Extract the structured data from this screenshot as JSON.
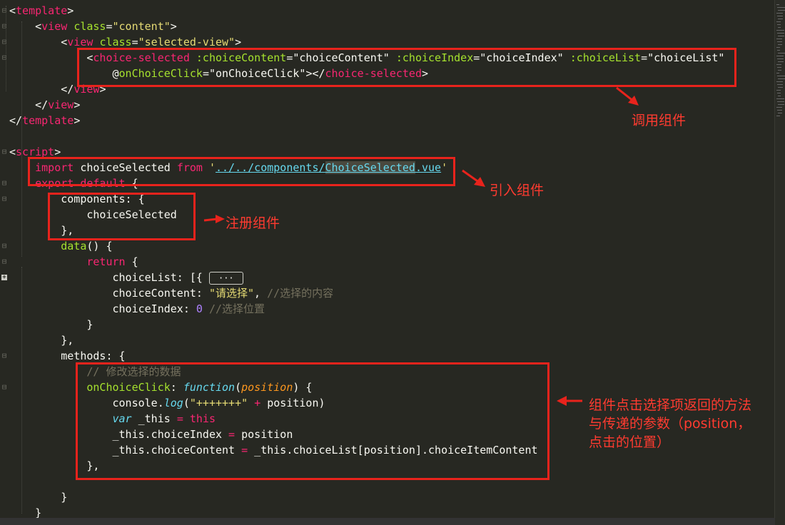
{
  "code_lines": [
    [
      {
        "c": "punc",
        "t": "<"
      },
      {
        "c": "tag",
        "t": "template"
      },
      {
        "c": "punc",
        "t": ">"
      }
    ],
    [
      {
        "c": "t",
        "t": "    "
      },
      {
        "c": "punc",
        "t": "<"
      },
      {
        "c": "tag",
        "t": "view"
      },
      {
        "c": "t",
        "t": " "
      },
      {
        "c": "attr",
        "t": "class"
      },
      {
        "c": "punc",
        "t": "="
      },
      {
        "c": "str",
        "t": "\"content\""
      },
      {
        "c": "punc",
        "t": ">"
      }
    ],
    [
      {
        "c": "t",
        "t": "        "
      },
      {
        "c": "punc",
        "t": "<"
      },
      {
        "c": "tag",
        "t": "view"
      },
      {
        "c": "t",
        "t": " "
      },
      {
        "c": "attr",
        "t": "class"
      },
      {
        "c": "punc",
        "t": "="
      },
      {
        "c": "str",
        "t": "\"selected-view\""
      },
      {
        "c": "punc",
        "t": ">"
      }
    ],
    [
      {
        "c": "t",
        "t": "            "
      },
      {
        "c": "punc",
        "t": "<"
      },
      {
        "c": "tag",
        "t": "choice-selected"
      },
      {
        "c": "t",
        "t": " "
      },
      {
        "c": "attr",
        "t": ":choiceContent"
      },
      {
        "c": "punc",
        "t": "="
      },
      {
        "c": "t",
        "t": "\"choiceContent\" "
      },
      {
        "c": "attr",
        "t": ":choiceIndex"
      },
      {
        "c": "punc",
        "t": "="
      },
      {
        "c": "t",
        "t": "\"choiceIndex\" "
      },
      {
        "c": "attr",
        "t": ":choiceList"
      },
      {
        "c": "punc",
        "t": "="
      },
      {
        "c": "t",
        "t": "\"choiceList\""
      }
    ],
    [
      {
        "c": "t",
        "t": "                "
      },
      {
        "c": "t",
        "t": "@"
      },
      {
        "c": "attr",
        "t": "onChoiceClick"
      },
      {
        "c": "punc",
        "t": "="
      },
      {
        "c": "t",
        "t": "\"onChoiceClick\""
      },
      {
        "c": "punc",
        "t": "></"
      },
      {
        "c": "tag",
        "t": "choice-selected"
      },
      {
        "c": "punc",
        "t": ">"
      }
    ],
    [
      {
        "c": "t",
        "t": "        "
      },
      {
        "c": "punc",
        "t": "</"
      },
      {
        "c": "tag",
        "t": "view"
      },
      {
        "c": "punc",
        "t": ">"
      }
    ],
    [
      {
        "c": "t",
        "t": "    "
      },
      {
        "c": "punc",
        "t": "</"
      },
      {
        "c": "tag",
        "t": "view"
      },
      {
        "c": "punc",
        "t": ">"
      }
    ],
    [
      {
        "c": "punc",
        "t": "</"
      },
      {
        "c": "tag",
        "t": "template"
      },
      {
        "c": "punc",
        "t": ">"
      }
    ],
    [],
    [
      {
        "c": "punc",
        "t": "<"
      },
      {
        "c": "tag",
        "t": "script"
      },
      {
        "c": "punc",
        "t": ">"
      }
    ],
    [
      {
        "c": "t",
        "t": "    "
      },
      {
        "c": "kw",
        "t": "import"
      },
      {
        "c": "t",
        "t": " choiceSelected "
      },
      {
        "c": "kw",
        "t": "from"
      },
      {
        "c": "t",
        "t": " "
      },
      {
        "c": "str",
        "t": "'"
      },
      {
        "c": "link",
        "t": "../../components/"
      },
      {
        "c": "link sel",
        "t": "ChoiceSelected"
      },
      {
        "c": "link",
        "t": ".vue"
      },
      {
        "c": "str",
        "t": "'"
      }
    ],
    [
      {
        "c": "t",
        "t": "    "
      },
      {
        "c": "kw",
        "t": "export"
      },
      {
        "c": "t",
        "t": " "
      },
      {
        "c": "kw",
        "t": "default"
      },
      {
        "c": "t",
        "t": " {"
      }
    ],
    [
      {
        "c": "t",
        "t": "        components: {"
      }
    ],
    [
      {
        "c": "t",
        "t": "            choiceSelected"
      }
    ],
    [
      {
        "c": "t",
        "t": "        },"
      }
    ],
    [
      {
        "c": "t",
        "t": "        "
      },
      {
        "c": "fn",
        "t": "data"
      },
      {
        "c": "t",
        "t": "() {"
      }
    ],
    [
      {
        "c": "t",
        "t": "            "
      },
      {
        "c": "kw",
        "t": "return"
      },
      {
        "c": "t",
        "t": " {"
      }
    ],
    [
      {
        "c": "t",
        "t": "                choiceList: [{ "
      },
      {
        "c": "fold-ellipsis",
        "t": "···"
      }
    ],
    [
      {
        "c": "t",
        "t": "                choiceContent: "
      },
      {
        "c": "str",
        "t": "\"请选择\""
      },
      {
        "c": "t",
        "t": ", "
      },
      {
        "c": "cm",
        "t": "//选择的内容"
      }
    ],
    [
      {
        "c": "t",
        "t": "                choiceIndex: "
      },
      {
        "c": "num",
        "t": "0"
      },
      {
        "c": "t",
        "t": " "
      },
      {
        "c": "cm",
        "t": "//选择位置"
      }
    ],
    [
      {
        "c": "t",
        "t": "            }"
      }
    ],
    [
      {
        "c": "t",
        "t": "        },"
      }
    ],
    [
      {
        "c": "t",
        "t": "        methods: {"
      }
    ],
    [
      {
        "c": "t",
        "t": "            "
      },
      {
        "c": "cm",
        "t": "// 修改选择的数据"
      }
    ],
    [
      {
        "c": "t",
        "t": "            "
      },
      {
        "c": "fn",
        "t": "onChoiceClick"
      },
      {
        "c": "t",
        "t": ": "
      },
      {
        "c": "em",
        "t": "function"
      },
      {
        "c": "t",
        "t": "("
      },
      {
        "c": "param",
        "t": "position"
      },
      {
        "c": "t",
        "t": ") {"
      }
    ],
    [
      {
        "c": "t",
        "t": "                console."
      },
      {
        "c": "em",
        "t": "log"
      },
      {
        "c": "t",
        "t": "("
      },
      {
        "c": "str",
        "t": "\"+++++++\""
      },
      {
        "c": "t",
        "t": " "
      },
      {
        "c": "kw",
        "t": "+"
      },
      {
        "c": "t",
        "t": " position)"
      }
    ],
    [
      {
        "c": "t",
        "t": "                "
      },
      {
        "c": "em",
        "t": "var"
      },
      {
        "c": "t",
        "t": " _this "
      },
      {
        "c": "kw",
        "t": "="
      },
      {
        "c": "t",
        "t": " "
      },
      {
        "c": "kw",
        "t": "this"
      }
    ],
    [
      {
        "c": "t",
        "t": "                _this.choiceIndex "
      },
      {
        "c": "kw",
        "t": "="
      },
      {
        "c": "t",
        "t": " position"
      }
    ],
    [
      {
        "c": "t",
        "t": "                _this.choiceContent "
      },
      {
        "c": "kw",
        "t": "="
      },
      {
        "c": "t",
        "t": " _this.choiceList[position].choiceItemContent"
      }
    ],
    [
      {
        "c": "t",
        "t": "            },"
      }
    ],
    [],
    [
      {
        "c": "t",
        "t": "        }"
      }
    ],
    [
      {
        "c": "t",
        "t": "    }"
      }
    ]
  ],
  "annotations": {
    "call_component": "调用组件",
    "import_component": "引入组件",
    "register_component": "注册组件",
    "callback_note": "组件点击选择项返回的方法\n与传递的参数（position，\n点击的位置）"
  },
  "colors": {
    "background": "#272822",
    "annotation_red": "#e8231c",
    "tag": "#f92672",
    "attr": "#a6e22e",
    "string": "#e6db74",
    "comment": "#75715e"
  }
}
